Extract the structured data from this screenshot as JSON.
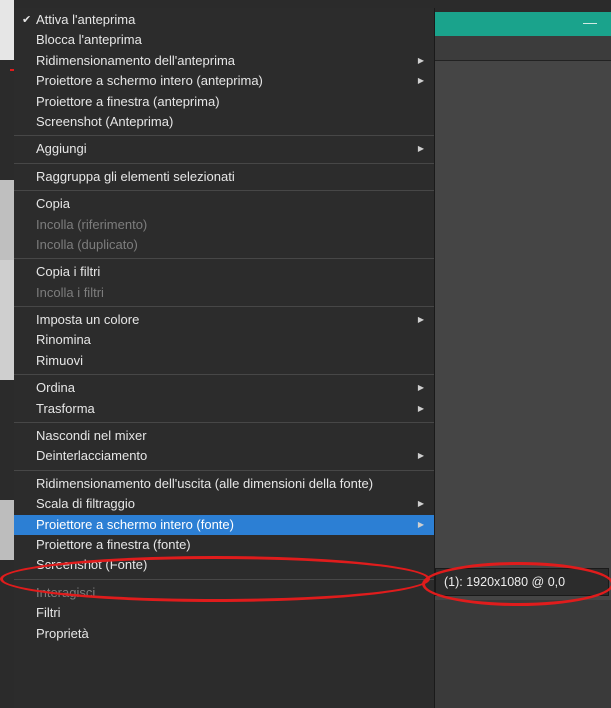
{
  "context_menu": {
    "items": [
      {
        "label": "Attiva l'anteprima",
        "checked": true
      },
      {
        "label": "Blocca l'anteprima"
      },
      {
        "label": "Ridimensionamento dell'anteprima",
        "submenu": true
      },
      {
        "label": "Proiettore a schermo intero (anteprima)",
        "submenu": true
      },
      {
        "label": "Proiettore a finestra (anteprima)"
      },
      {
        "label": "Screenshot (Anteprima)"
      },
      {
        "separator": true
      },
      {
        "label": "Aggiungi",
        "submenu": true
      },
      {
        "separator": true
      },
      {
        "label": "Raggruppa gli elementi selezionati"
      },
      {
        "separator": true
      },
      {
        "label": "Copia"
      },
      {
        "label": "Incolla (riferimento)",
        "disabled": true
      },
      {
        "label": "Incolla (duplicato)",
        "disabled": true
      },
      {
        "separator": true
      },
      {
        "label": "Copia i filtri"
      },
      {
        "label": "Incolla i filtri",
        "disabled": true
      },
      {
        "separator": true
      },
      {
        "label": "Imposta un colore",
        "submenu": true
      },
      {
        "label": "Rinomina"
      },
      {
        "label": "Rimuovi"
      },
      {
        "separator": true
      },
      {
        "label": "Ordina",
        "submenu": true
      },
      {
        "label": "Trasforma",
        "submenu": true
      },
      {
        "separator": true
      },
      {
        "label": "Nascondi nel mixer"
      },
      {
        "label": "Deinterlacciamento",
        "submenu": true
      },
      {
        "separator": true
      },
      {
        "label": "Ridimensionamento dell'uscita (alle dimensioni della fonte)"
      },
      {
        "label": "Scala di filtraggio",
        "submenu": true
      },
      {
        "label": "Proiettore a schermo intero (fonte)",
        "submenu": true,
        "highlighted": true
      },
      {
        "label": "Proiettore a finestra (fonte)"
      },
      {
        "label": "Screenshot (Fonte)"
      },
      {
        "separator": true
      },
      {
        "label": "Interagisci",
        "disabled": true
      },
      {
        "label": "Filtri"
      },
      {
        "label": "Proprietà"
      }
    ]
  },
  "submenu": {
    "label": "(1): 1920x1080 @ 0,0"
  },
  "window": {
    "minimize_label": "—"
  },
  "colors": {
    "highlight": "#2c7fd4",
    "accent": "#1aa38c",
    "annotation": "#e01c1c"
  },
  "icons": {
    "check": "check-icon",
    "submenu_arrow": "chevron-right-icon"
  }
}
